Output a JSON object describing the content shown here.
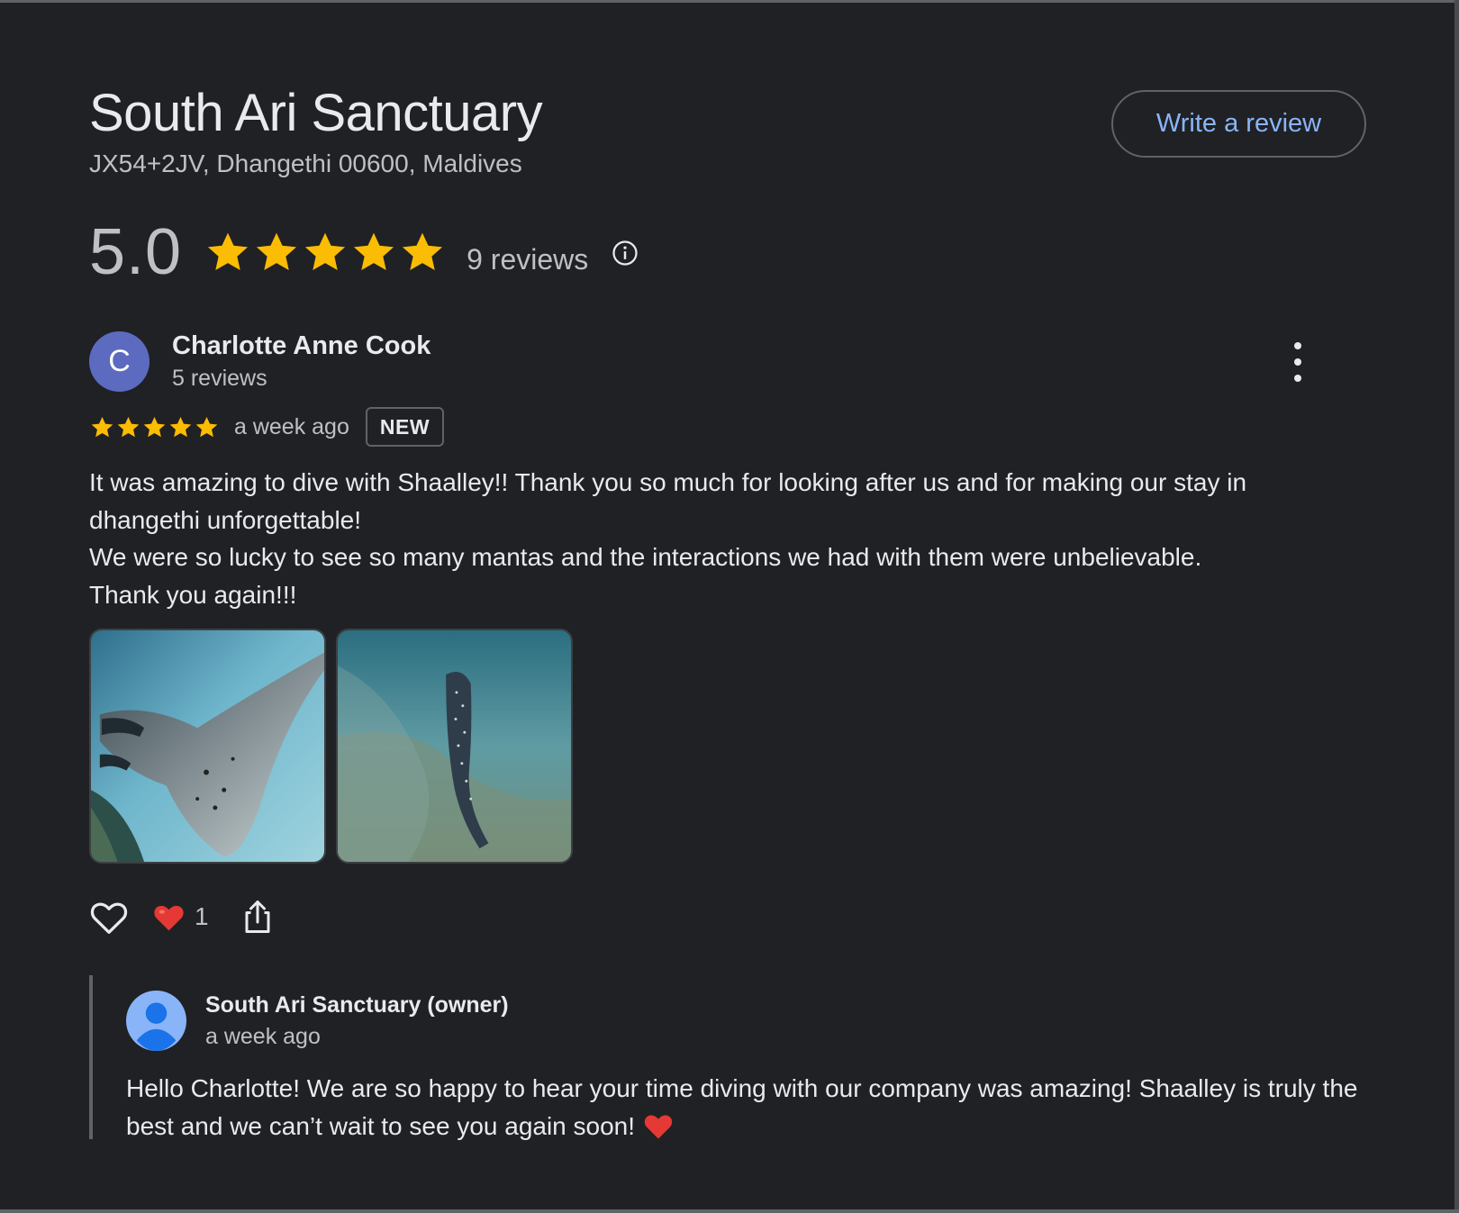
{
  "place": {
    "title": "South Ari Sanctuary",
    "address": "JX54+2JV, Dhangethi 00600, Maldives",
    "write_review_label": "Write a review"
  },
  "rating": {
    "value": "5.0",
    "stars": 5,
    "count_label": "9 reviews",
    "star_color": "#fbbc04"
  },
  "review": {
    "avatar_letter": "C",
    "avatar_color": "#5c6bc0",
    "author": "Charlotte Anne Cook",
    "author_reviews": "5 reviews",
    "stars": 5,
    "time": "a week ago",
    "badge": "NEW",
    "text_line1": "It was amazing to dive with Shaalley!! Thank you so much for looking after us and for making our stay in",
    "text_line2": "dhangethi unforgettable!",
    "text_line3": "We were so lucky to see so many mantas and the interactions we had with them were unbelievable.",
    "text_line4": "Thank you again!!!",
    "photos": [
      "manta-ray-photo",
      "whale-shark-photo"
    ],
    "reaction_count": "1"
  },
  "owner_reply": {
    "name": "South Ari Sanctuary (owner)",
    "time": "a week ago",
    "text": "Hello Charlotte! We are so happy to hear your time diving with our company was amazing! Shaalley is truly the best and we can’t wait to see you again soon!"
  },
  "colors": {
    "background": "#202124",
    "link": "#8ab4f8",
    "heart": "#e53935"
  }
}
